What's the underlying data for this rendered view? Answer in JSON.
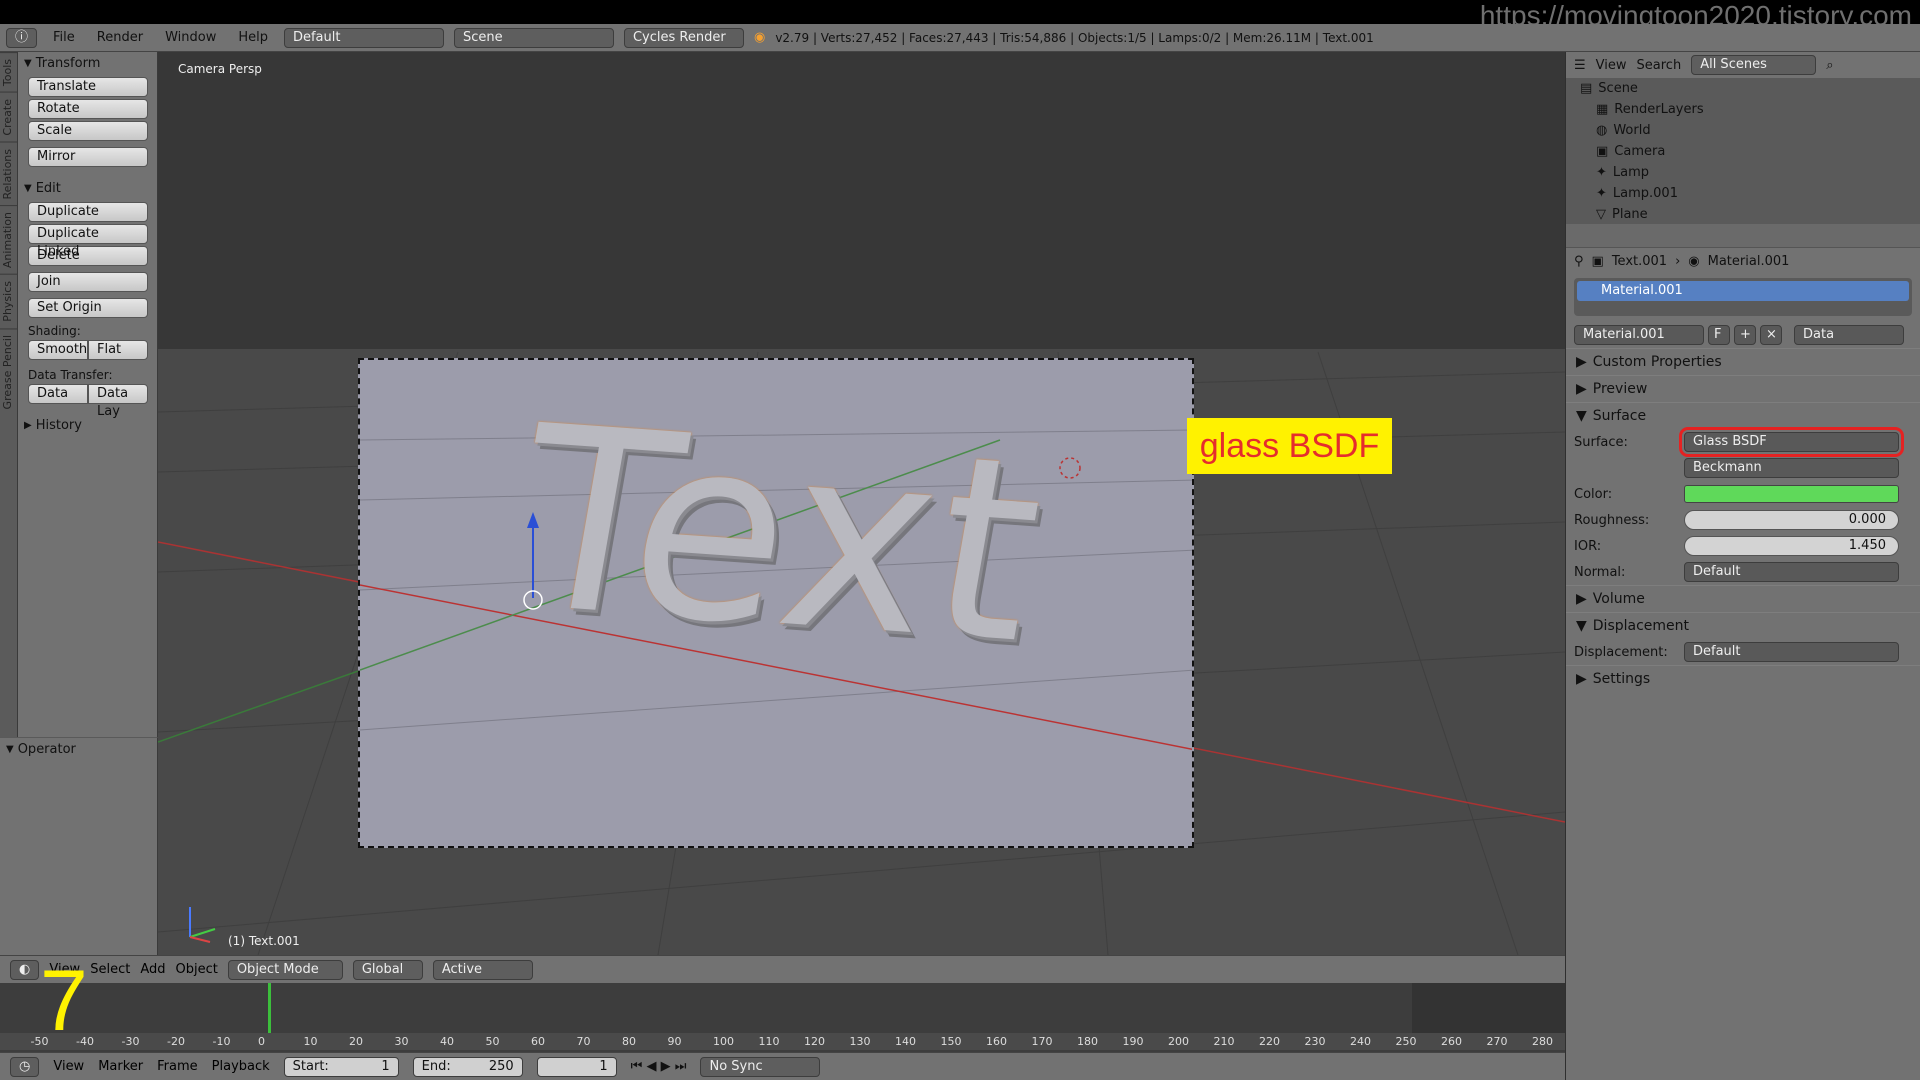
{
  "url": "https://movingtoon2020.tistory.com",
  "menu": {
    "items": [
      "File",
      "Render",
      "Window",
      "Help"
    ]
  },
  "layout": "Default",
  "scene": "Scene",
  "engine": "Cycles Render",
  "stats": "v2.79 | Verts:27,452 | Faces:27,443 | Tris:54,886 | Objects:1/5 | Lamps:0/2 | Mem:26.11M | Text.001",
  "lefttabs": [
    "Tools",
    "Create",
    "Relations",
    "Animation",
    "Physics",
    "Grease Pencil"
  ],
  "tools": {
    "transform_title": "Transform",
    "transform": [
      "Translate",
      "Rotate",
      "Scale"
    ],
    "mirror": "Mirror",
    "edit_title": "Edit",
    "edit": [
      "Duplicate",
      "Duplicate Linked",
      "Delete"
    ],
    "join": "Join",
    "set_origin": "Set Origin",
    "shading_label": "Shading:",
    "smooth": "Smooth",
    "flat": "Flat",
    "transfer_label": "Data Transfer:",
    "data": "Data",
    "datalay": "Data Lay",
    "history": "History",
    "operator": "Operator"
  },
  "viewport": {
    "label": "Camera Persp",
    "object": "(1) Text.001",
    "text3d": "Text",
    "badge": "glass BSDF"
  },
  "header3d": {
    "items": [
      "View",
      "Select",
      "Add",
      "Object"
    ],
    "mode": "Object Mode",
    "orientation": "Global",
    "pivot": "Active"
  },
  "timeline": {
    "ticks": [
      "-50",
      "-40",
      "-30",
      "-20",
      "-10",
      "0",
      "10",
      "20",
      "30",
      "40",
      "50",
      "60",
      "70",
      "80",
      "90",
      "100",
      "110",
      "120",
      "130",
      "140",
      "150",
      "160",
      "170",
      "180",
      "190",
      "200",
      "210",
      "220",
      "230",
      "240",
      "250",
      "260",
      "270",
      "280"
    ]
  },
  "footer": {
    "items": [
      "View",
      "Marker",
      "Frame",
      "Playback"
    ],
    "start": "Start:",
    "start_val": "1",
    "end": "End:",
    "end_val": "250",
    "frame": "1",
    "sync": "No Sync"
  },
  "overlay_number": "7",
  "outliner": {
    "view": "View",
    "search": "Search",
    "filter": "All Scenes",
    "rows": [
      "Scene",
      "RenderLayers",
      "World",
      "Camera",
      "Lamp",
      "Lamp.001",
      "Plane"
    ]
  },
  "props": {
    "breadcrumb_obj": "Text.001",
    "breadcrumb_mat": "Material.001",
    "slot": "Material.001",
    "datablock": "Material.001",
    "f": "F",
    "link": "Data",
    "custom_properties": "Custom Properties",
    "preview": "Preview",
    "surface_section": "Surface",
    "surface_label": "Surface:",
    "surface_value": "Glass BSDF",
    "distribution": "Beckmann",
    "color_label": "Color:",
    "color_hex": "#5fd95a",
    "roughness_label": "Roughness:",
    "roughness": "0.000",
    "ior_label": "IOR:",
    "ior": "1.450",
    "normal_label": "Normal:",
    "normal": "Default",
    "volume": "Volume",
    "displacement_section": "Displacement",
    "displacement_label": "Displacement:",
    "displacement": "Default",
    "settings": "Settings"
  }
}
